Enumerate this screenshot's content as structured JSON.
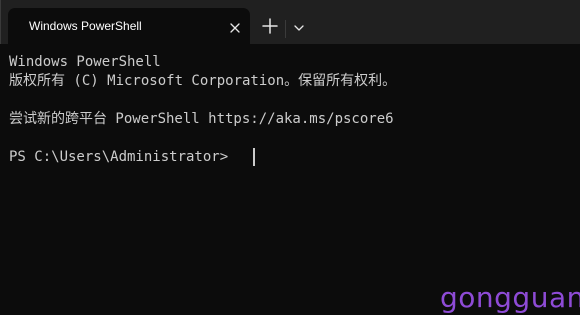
{
  "tab": {
    "title": "Windows PowerShell"
  },
  "terminal": {
    "lines": [
      "Windows PowerShell",
      "版权所有 (C) Microsoft Corporation。保留所有权利。",
      "",
      "尝试新的跨平台 PowerShell https://aka.ms/pscore6",
      "",
      "PS C:\\Users\\Administrator>"
    ]
  },
  "watermark": {
    "text": "gongguan"
  },
  "colors": {
    "background": "#0c0c0c",
    "titlebar": "#202020",
    "text": "#cccccc",
    "watermark": "#8e4bd6"
  },
  "icons": {
    "close": "close-icon",
    "new_tab": "plus-icon",
    "dropdown": "chevron-down-icon"
  }
}
